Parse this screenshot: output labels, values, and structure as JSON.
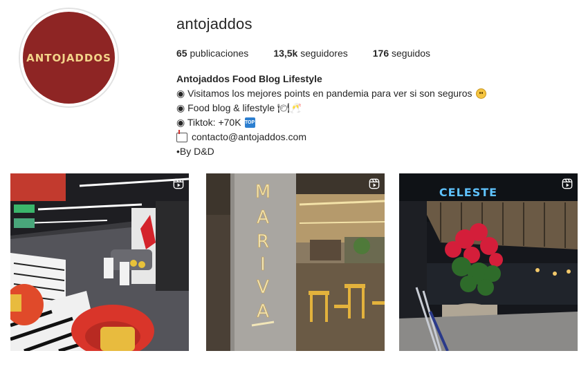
{
  "profile": {
    "avatar_text": "ANTOJADDOS",
    "username": "antojaddos"
  },
  "stats": {
    "posts_count": "65",
    "posts_label": "publicaciones",
    "followers_count": "13,5k",
    "followers_label": "seguidores",
    "following_count": "176",
    "following_label": "seguidos"
  },
  "bio": {
    "name": "Antojaddos Food Blog Lifestyle",
    "line1": "◉ Visitamos los mejores points en pandemia para ver si son seguros",
    "line2": "◉ Food blog & lifestyle 🍽🥂",
    "line3": "◉ Tiktok: +70K",
    "email": "contacto@antojaddos.com",
    "signature": "•By D&D"
  },
  "posts": [
    {
      "icon": "reels-icon"
    },
    {
      "icon": "reels-icon",
      "sign_text": "MARIVA"
    },
    {
      "icon": "reels-icon",
      "sign_text": "CELESTE"
    }
  ],
  "colors": {
    "avatar_bg": "#8e2524",
    "avatar_text": "#f3d48a",
    "text": "#262626"
  }
}
